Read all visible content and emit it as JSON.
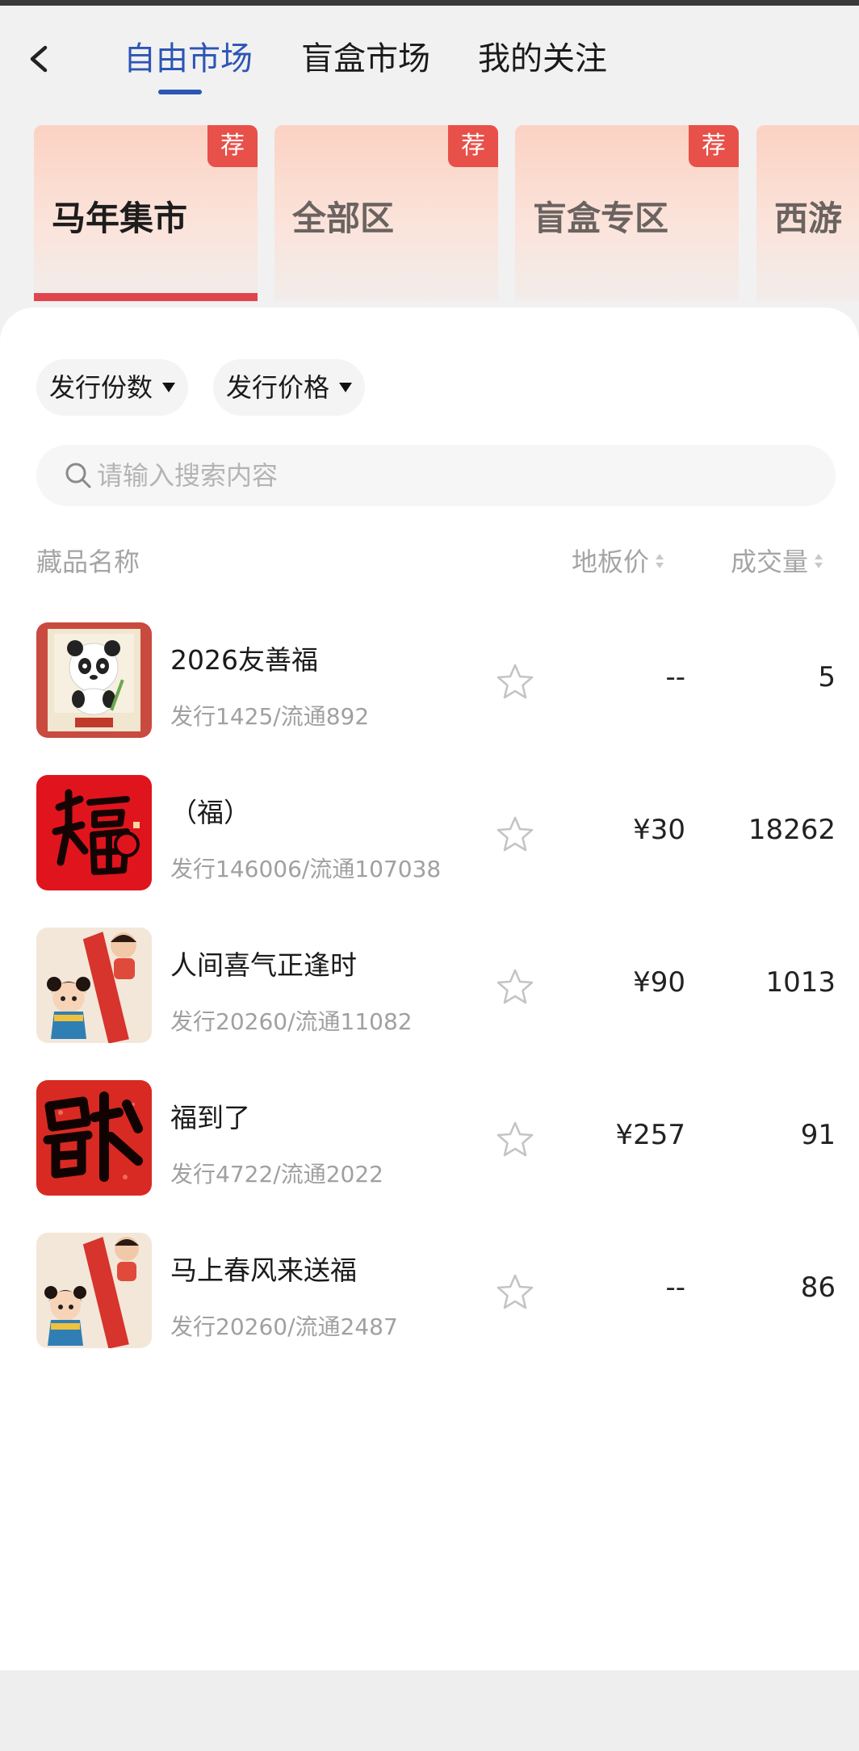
{
  "header": {
    "tabs": [
      {
        "label": "自由市场",
        "active": true
      },
      {
        "label": "盲盒市场",
        "active": false
      },
      {
        "label": "我的关注",
        "active": false
      }
    ],
    "active_color": "#2c55b6"
  },
  "categories": [
    {
      "label": "马年集市",
      "badge": "荐",
      "active": true
    },
    {
      "label": "全部区",
      "badge": "荐",
      "active": false
    },
    {
      "label": "盲盒专区",
      "badge": "荐",
      "active": false
    },
    {
      "label": "西游",
      "badge": "",
      "active": false
    }
  ],
  "filters": [
    {
      "label": "发行份数"
    },
    {
      "label": "发行价格"
    }
  ],
  "search": {
    "placeholder": "请输入搜索内容",
    "value": ""
  },
  "columns": {
    "name": "藏品名称",
    "price": "地板价",
    "volume": "成交量"
  },
  "items": [
    {
      "name": "2026友善福",
      "meta": "发行1425/流通892",
      "price": "--",
      "volume": "5",
      "image": "panda-scroll"
    },
    {
      "name": "（福）",
      "meta": "发行146006/流通107038",
      "price": "¥30",
      "volume": "18262",
      "image": "fu-calligraphy-red"
    },
    {
      "name": "人间喜气正逢时",
      "meta": "发行20260/流通11082",
      "price": "¥90",
      "volume": "1013",
      "image": "child-couplet"
    },
    {
      "name": "福到了",
      "meta": "发行4722/流通2022",
      "price": "¥257",
      "volume": "91",
      "image": "fu-upside-down"
    },
    {
      "name": "马上春风来送福",
      "meta": "发行20260/流通2487",
      "price": "--",
      "volume": "86",
      "image": "child-couplet"
    }
  ],
  "colors": {
    "badge": "#e8504a",
    "active_bar": "#e0454d",
    "accent": "#2c55b6"
  }
}
